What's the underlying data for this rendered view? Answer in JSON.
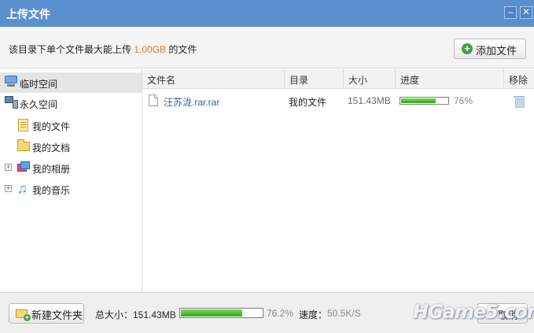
{
  "window": {
    "title": "上传文件",
    "minimize_icon": "minimize-icon",
    "close_icon": "close-icon"
  },
  "info": {
    "text_before": "该目录下单个文件最大能上传 ",
    "limit": "1.00GB",
    "text_after": " 的文件",
    "limit_color": "#e8762b"
  },
  "toolbar": {
    "add_file_label": "添加文件",
    "add_file_icon": "plus-circle-icon"
  },
  "sidebar": {
    "items": [
      {
        "label": "临时空间",
        "icon": "computer-icon",
        "selected": true
      },
      {
        "label": "永久空间",
        "icon": "server-icon"
      },
      {
        "label": "我的文件",
        "icon": "document-icon"
      },
      {
        "label": "我的文档",
        "icon": "folder-icon"
      },
      {
        "label": "我的相册",
        "icon": "album-icon",
        "expandable": true
      },
      {
        "label": "我的音乐",
        "icon": "music-icon",
        "expandable": true
      }
    ]
  },
  "table": {
    "columns": [
      "文件名",
      "目录",
      "大小",
      "进度",
      "移除"
    ],
    "rows": [
      {
        "name": "汪苏泷.rar.rar",
        "directory": "我的文件",
        "size": "151.43MB",
        "progress_label": "76%",
        "progress_value": 76
      }
    ]
  },
  "footer": {
    "new_folder_label": "新建文件夹",
    "total_size_label": "总大小：151.43MB",
    "total_progress_label": "76.2%",
    "total_progress_value": 76.2,
    "speed_label": "速度：",
    "speed_value": "50.5K/S",
    "cancel_label": "取消"
  },
  "watermark": "HGame5.com",
  "colors": {
    "titlebar": "#5b90cf",
    "accent": "#e8762b",
    "progress": "#2ea51b",
    "link": "#2d63a8"
  }
}
